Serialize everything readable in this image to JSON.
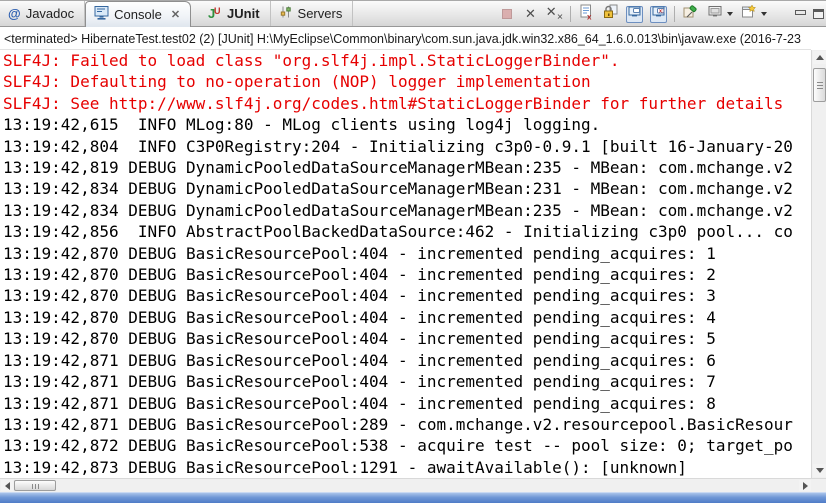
{
  "tabs": [
    {
      "label": "Javadoc",
      "icon": "javadoc-icon"
    },
    {
      "label": "Console",
      "icon": "console-icon",
      "close_label": "✕"
    },
    {
      "label": "JUnit",
      "icon": "junit-icon"
    },
    {
      "label": "Servers",
      "icon": "servers-icon"
    }
  ],
  "toolbar": {
    "terminate": {
      "title": "Terminate"
    },
    "remove": {
      "title": "Remove Launch"
    },
    "remove_all": {
      "title": "Remove All Terminated Launches"
    },
    "clear": {
      "title": "Clear Console"
    },
    "scroll_lock": {
      "title": "Scroll Lock"
    },
    "show_stdout": {
      "title": "Show Console When Standard Out Changes"
    },
    "show_stderr": {
      "title": "Show Console When Standard Error Changes"
    },
    "pin": {
      "title": "Pin Console"
    },
    "display": {
      "title": "Display Selected Console"
    },
    "open": {
      "title": "Open Console"
    },
    "minimize": {
      "title": "Minimize"
    },
    "maximize": {
      "title": "Maximize"
    }
  },
  "console": {
    "header": "<terminated> HibernateTest.test02 (2) [JUnit] H:\\MyEclipse\\Common\\binary\\com.sun.java.jdk.win32.x86_64_1.6.0.013\\bin\\javaw.exe (2016-7-23",
    "lines": [
      {
        "type": "stderr",
        "text": "SLF4J: Failed to load class \"org.slf4j.impl.StaticLoggerBinder\"."
      },
      {
        "type": "stderr",
        "text": "SLF4J: Defaulting to no-operation (NOP) logger implementation"
      },
      {
        "type": "stderr",
        "text": "SLF4J: See http://www.slf4j.org/codes.html#StaticLoggerBinder for further details"
      },
      {
        "type": "stdout",
        "text": "13:19:42,615  INFO MLog:80 - MLog clients using log4j logging."
      },
      {
        "type": "stdout",
        "text": "13:19:42,804  INFO C3P0Registry:204 - Initializing c3p0-0.9.1 [built 16-January-20"
      },
      {
        "type": "stdout",
        "text": "13:19:42,819 DEBUG DynamicPooledDataSourceManagerMBean:235 - MBean: com.mchange.v2"
      },
      {
        "type": "stdout",
        "text": "13:19:42,834 DEBUG DynamicPooledDataSourceManagerMBean:231 - MBean: com.mchange.v2"
      },
      {
        "type": "stdout",
        "text": "13:19:42,834 DEBUG DynamicPooledDataSourceManagerMBean:235 - MBean: com.mchange.v2"
      },
      {
        "type": "stdout",
        "text": "13:19:42,856  INFO AbstractPoolBackedDataSource:462 - Initializing c3p0 pool... co"
      },
      {
        "type": "stdout",
        "text": "13:19:42,870 DEBUG BasicResourcePool:404 - incremented pending_acquires: 1"
      },
      {
        "type": "stdout",
        "text": "13:19:42,870 DEBUG BasicResourcePool:404 - incremented pending_acquires: 2"
      },
      {
        "type": "stdout",
        "text": "13:19:42,870 DEBUG BasicResourcePool:404 - incremented pending_acquires: 3"
      },
      {
        "type": "stdout",
        "text": "13:19:42,870 DEBUG BasicResourcePool:404 - incremented pending_acquires: 4"
      },
      {
        "type": "stdout",
        "text": "13:19:42,870 DEBUG BasicResourcePool:404 - incremented pending_acquires: 5"
      },
      {
        "type": "stdout",
        "text": "13:19:42,871 DEBUG BasicResourcePool:404 - incremented pending_acquires: 6"
      },
      {
        "type": "stdout",
        "text": "13:19:42,871 DEBUG BasicResourcePool:404 - incremented pending_acquires: 7"
      },
      {
        "type": "stdout",
        "text": "13:19:42,871 DEBUG BasicResourcePool:404 - incremented pending_acquires: 8"
      },
      {
        "type": "stdout",
        "text": "13:19:42,871 DEBUG BasicResourcePool:289 - com.mchange.v2.resourcepool.BasicResour"
      },
      {
        "type": "stdout",
        "text": "13:19:42,872 DEBUG BasicResourcePool:538 - acquire test -- pool size: 0; target_po"
      },
      {
        "type": "stdout",
        "text": "13:19:42,873 DEBUG BasicResourcePool:1291 - awaitAvailable(): [unknown]"
      }
    ]
  },
  "colors": {
    "stderr_text": "#e60000",
    "stdout_text": "#000000",
    "strip_blue": "#4a77c4"
  }
}
